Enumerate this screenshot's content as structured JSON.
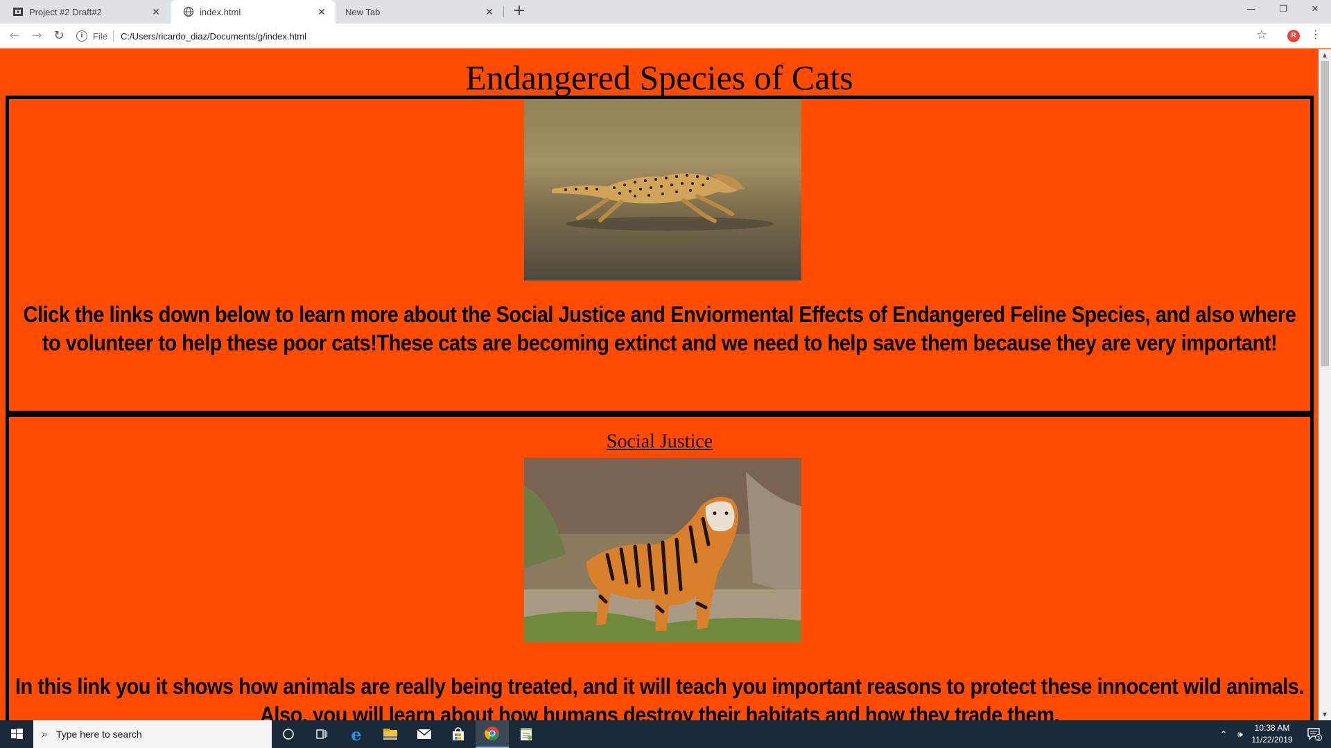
{
  "browser": {
    "tabs": [
      {
        "title": "Project #2 Draft#2",
        "icon": "slides-icon",
        "active": false
      },
      {
        "title": "index.html",
        "icon": "globe-icon",
        "active": true
      },
      {
        "title": "New Tab",
        "icon": "",
        "active": false
      }
    ],
    "new_tab_label": "+",
    "address": {
      "scheme_label": "File",
      "url": "C:/Users/ricardo_diaz/Documents/g/index.html"
    },
    "profile_initial": "R"
  },
  "page": {
    "title": "Endangered Species of Cats",
    "intro_text": "Click the links down below to learn more about the Social Justice and Enviormental Effects of Endangered Feline Species, and also where to volunteer to help these poor cats!These cats are becoming extinct and we need to help save them because they are very important!",
    "sections": [
      {
        "link_label": "Social Justice",
        "text": "In this link you it shows how animals are really being treated, and it will teach you important reasons to protect these innocent wild animals. Also, you will learn about how humans destroy their habitats and how they trade them."
      }
    ],
    "colors": {
      "background": "#ff4c00",
      "border": "#000000"
    }
  },
  "taskbar": {
    "search_placeholder": "Type here to search",
    "clock_time": "10:38 AM",
    "clock_date": "11/22/2019",
    "notification_count": "3"
  }
}
